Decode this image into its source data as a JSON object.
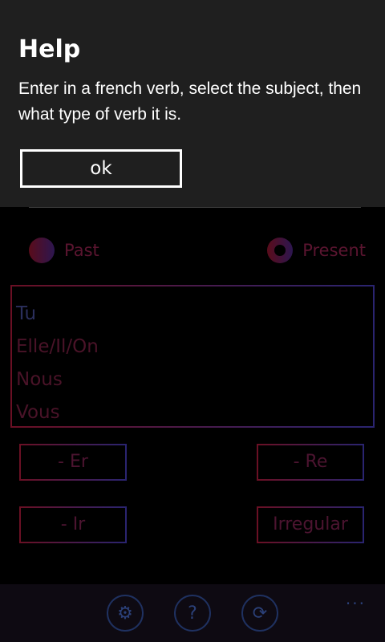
{
  "dialog": {
    "title": "Help",
    "body": "Enter in a french verb, select the subject, then what type of verb it is.",
    "ok_label": "ok"
  },
  "tense": {
    "past_label": "Past",
    "present_label": "Present",
    "selected": "Present"
  },
  "subjects": [
    "Tu",
    "Elle/Il/On",
    "Nous",
    "Vous"
  ],
  "verb_types": {
    "er_label": "- Er",
    "re_label": "- Re",
    "ir_label": "- Ir",
    "irregular_label": "Irregular"
  },
  "appbar": {
    "icons": [
      "gear-icon",
      "question-icon",
      "refresh-icon"
    ],
    "more_label": "..."
  },
  "colors": {
    "dialog_background": "#1f1f1f",
    "accent_red": "#6a1024",
    "accent_blue": "#2a2470"
  }
}
